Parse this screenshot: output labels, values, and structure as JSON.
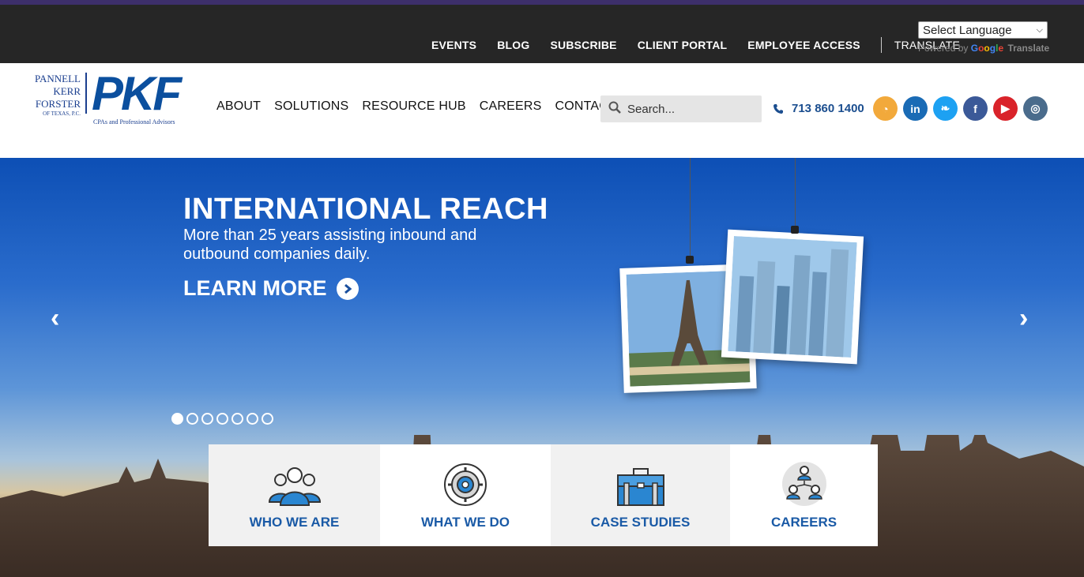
{
  "topbar": {
    "links": [
      "EVENTS",
      "BLOG",
      "SUBSCRIBE",
      "CLIENT PORTAL",
      "EMPLOYEE ACCESS"
    ],
    "translate": "TRANSLATE",
    "language_select": "Select Language",
    "powered_by": "Powered by",
    "google": [
      "G",
      "o",
      "o",
      "g",
      "l",
      "e"
    ],
    "translate_brand": "Translate"
  },
  "logo": {
    "line1": "PANNELL",
    "line2": "KERR",
    "line3": "FORSTER",
    "line4": "OF TEXAS, P.C.",
    "mark": "PKF",
    "tagline": "CPAs and Professional Advisors"
  },
  "nav": [
    "ABOUT",
    "SOLUTIONS",
    "RESOURCE HUB",
    "CAREERS",
    "CONTACT"
  ],
  "search": {
    "placeholder": "Search..."
  },
  "phone": "713 860 1400",
  "socials": [
    {
      "name": "rss-icon",
      "color": "#f2a93b",
      "glyph": "◔"
    },
    {
      "name": "linkedin-icon",
      "color": "#1a6bb5",
      "glyph": "in"
    },
    {
      "name": "twitter-icon",
      "color": "#1da1f2",
      "glyph": "❧"
    },
    {
      "name": "facebook-icon",
      "color": "#3b5998",
      "glyph": "f"
    },
    {
      "name": "youtube-icon",
      "color": "#d9232a",
      "glyph": "▶"
    },
    {
      "name": "instagram-icon",
      "color": "#4a6c8c",
      "glyph": "◎"
    }
  ],
  "hero": {
    "title": "INTERNATIONAL REACH",
    "subtitle": "More than 25 years assisting inbound and outbound companies daily.",
    "cta": "LEARN MORE",
    "slides": 7,
    "active_slide": 1
  },
  "tiles": [
    {
      "label": "WHO WE ARE",
      "icon": "team-icon"
    },
    {
      "label": "WHAT WE DO",
      "icon": "gear-icon"
    },
    {
      "label": "CASE STUDIES",
      "icon": "briefcase-icon"
    },
    {
      "label": "CAREERS",
      "icon": "network-icon"
    }
  ],
  "colors": {
    "topbar": "#262626",
    "accent_stripe": "#3d2f6b",
    "brand_blue": "#0b4f9e",
    "tile_text": "#1a5aa6"
  }
}
